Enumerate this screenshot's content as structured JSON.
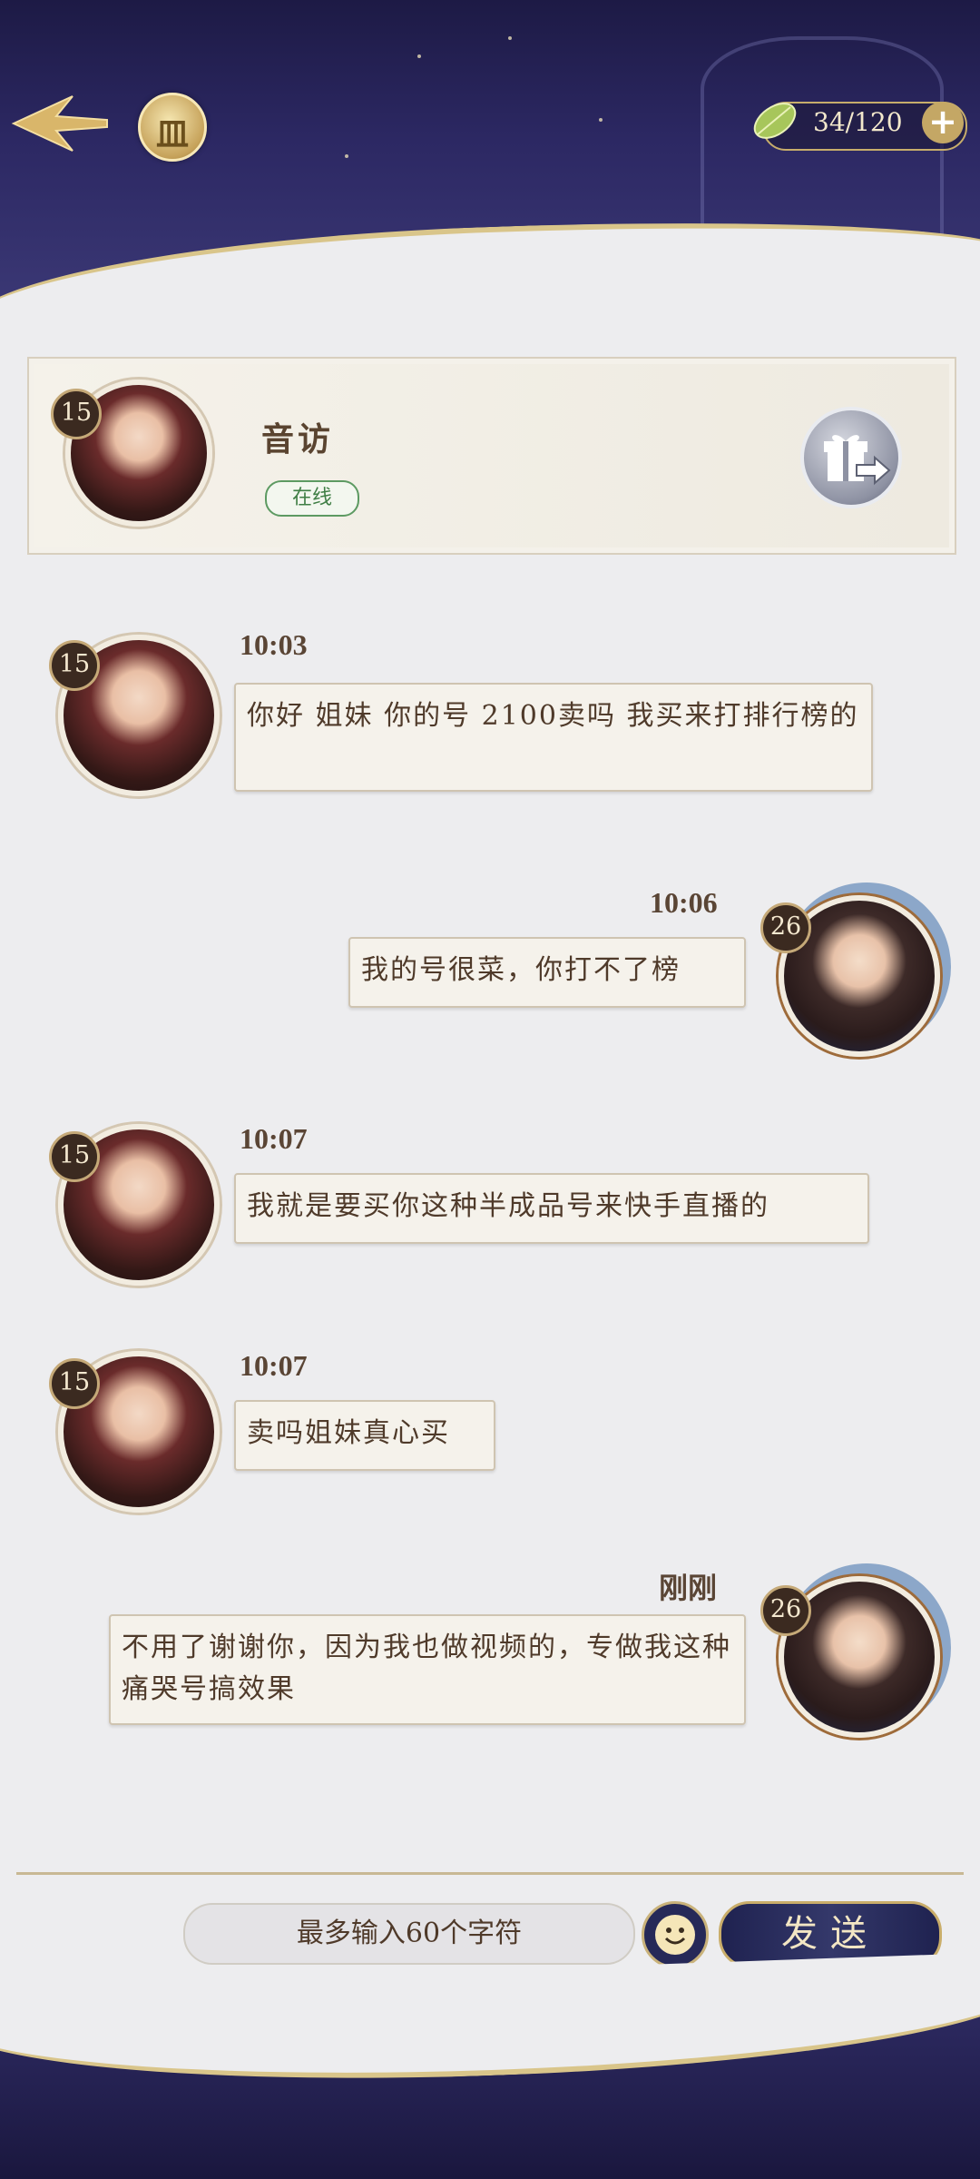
{
  "header": {
    "energy": "34/120",
    "plus": "+",
    "rank_glyph": "皿"
  },
  "contact": {
    "name": "音访",
    "level": "15",
    "status": "在线"
  },
  "self": {
    "level": "26"
  },
  "messages": [
    {
      "time": "10:03",
      "text": "你好 姐妹 你的号 2100卖吗 我买来打排行榜的",
      "level": "15"
    },
    {
      "time": "10:06",
      "text": "我的号很菜，你打不了榜",
      "level": "26"
    },
    {
      "time": "10:07",
      "text": "我就是要买你这种半成品号来快手直播的",
      "level": "15"
    },
    {
      "time": "10:07",
      "text": "卖吗姐妹真心买",
      "level": "15"
    },
    {
      "time": "刚刚",
      "text": "不用了谢谢你，因为我也做视频的，专做我这种痛哭号搞效果",
      "level": "26"
    }
  ],
  "input": {
    "placeholder": "最多输入60个字符"
  },
  "send_label": "发送",
  "colors": {
    "night": "#2c2863",
    "gold": "#c9ad6a",
    "paper": "#f5f2eb",
    "online": "#3f7e45"
  }
}
